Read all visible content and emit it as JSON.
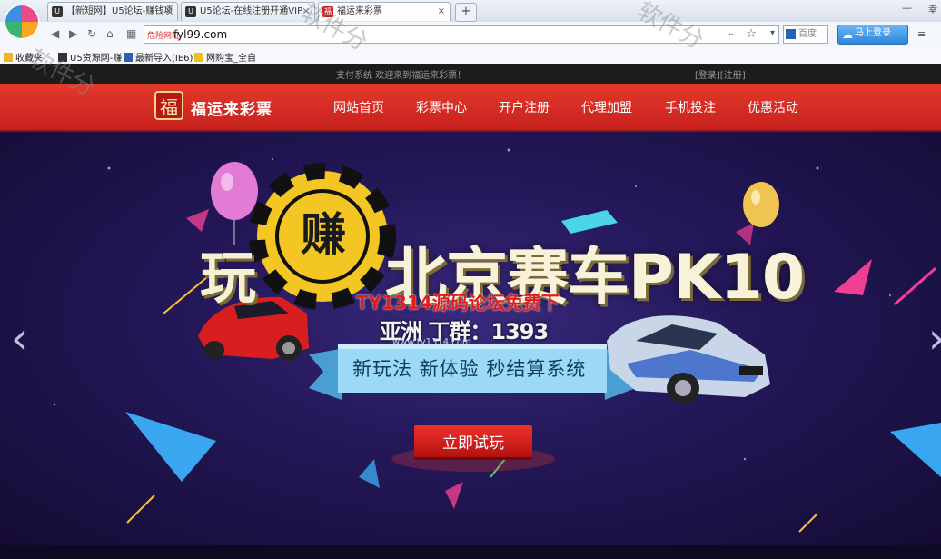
{
  "browser": {
    "tabs": [
      {
        "label": "【新短网】U5论坛-赚钱项",
        "icon": "u5-icon",
        "active": false
      },
      {
        "label": "U5论坛-在线注册开通VIP",
        "icon": "u5-icon",
        "active": false
      },
      {
        "label": "福运来彩票",
        "icon": "site-favicon",
        "active": true
      }
    ],
    "new_tab": "+",
    "close_glyph": "×",
    "window_right": "幸",
    "min_glyph": "—",
    "address": {
      "safe_label": "危险网址",
      "url": "fyl99.com",
      "dropdown": "⌄",
      "star": "☆",
      "go": "▾"
    },
    "search": {
      "placeholder": "百度"
    },
    "login_button": "马上登录",
    "favorites": [
      {
        "label": "收藏夹",
        "icon": "star-folder-icon"
      },
      {
        "label": "U5资源网-赚",
        "icon": "u5-icon"
      },
      {
        "label": "最新导入(IE6)",
        "icon": "ie-icon"
      },
      {
        "label": "网购宝_全自",
        "icon": "shop-icon"
      }
    ]
  },
  "site": {
    "topstrip_left": "支付系统 欢迎来到福运来彩票！",
    "topstrip_right": "[登录][注册]",
    "logo_seal": "福",
    "logo_text": "福运来彩票",
    "nav": [
      "网站首页",
      "彩票中心",
      "开户注册",
      "代理加盟",
      "手机投注",
      "优惠活动"
    ]
  },
  "banner": {
    "play": "玩",
    "coin": "赚",
    "title": "北京赛车PK10",
    "slogan": "新玩法 新体验 秒结算系统",
    "cta": "立即试玩",
    "prev": "‹",
    "next": "›",
    "overlay_red": "TY1314源码论坛免费下",
    "overlay_num": "亚洲 丁群：1393",
    "overlay_url": "www.ty1314.com",
    "watermark": "软件分"
  },
  "colors": {
    "nav_red": "#d62a22",
    "banner_bg": "#24185a",
    "cta_red": "#d81f1c",
    "ribbon_blue": "#8fd3f4"
  }
}
